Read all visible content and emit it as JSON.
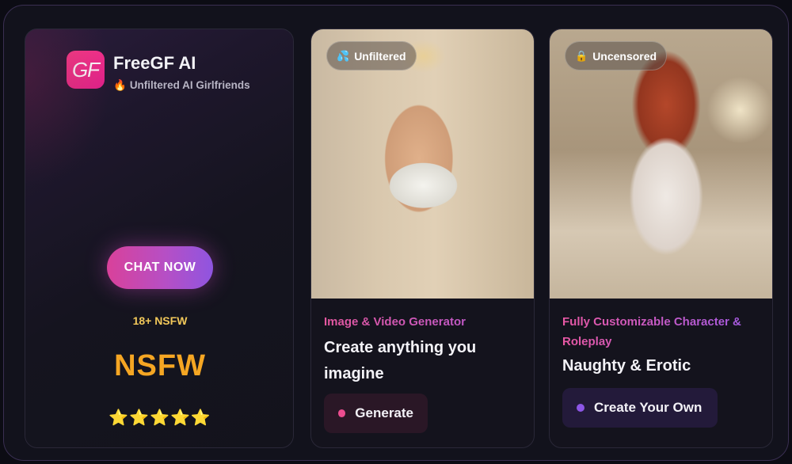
{
  "brand": {
    "logo_text": "GF",
    "title": "FreeGF AI",
    "subtitle_icon": "🔥",
    "subtitle": "Unfiltered AI Girlfriends",
    "cta_label": "CHAT NOW",
    "age_badge": "18+ NSFW",
    "headline": "NSFW",
    "stars": "⭐⭐⭐⭐⭐",
    "rating": 5
  },
  "cards": [
    {
      "tag_icon": "💦",
      "tag": "Unfiltered",
      "kicker": "Image & Video Generator",
      "heading": "Create anything you imagine",
      "button": "Generate",
      "accent": "#ec4d8f"
    },
    {
      "tag_icon": "🔒",
      "tag": "Uncensored",
      "kicker": "Fully Customizable Character & Roleplay",
      "heading": "Naughty & Erotic",
      "button": "Create Your Own",
      "accent": "#8d56e6"
    }
  ],
  "colors": {
    "background": "#12121c",
    "brand_pink": "#ff3d8b",
    "nsfw_orange": "#f5a623",
    "badge_gold": "#f2c85a"
  }
}
